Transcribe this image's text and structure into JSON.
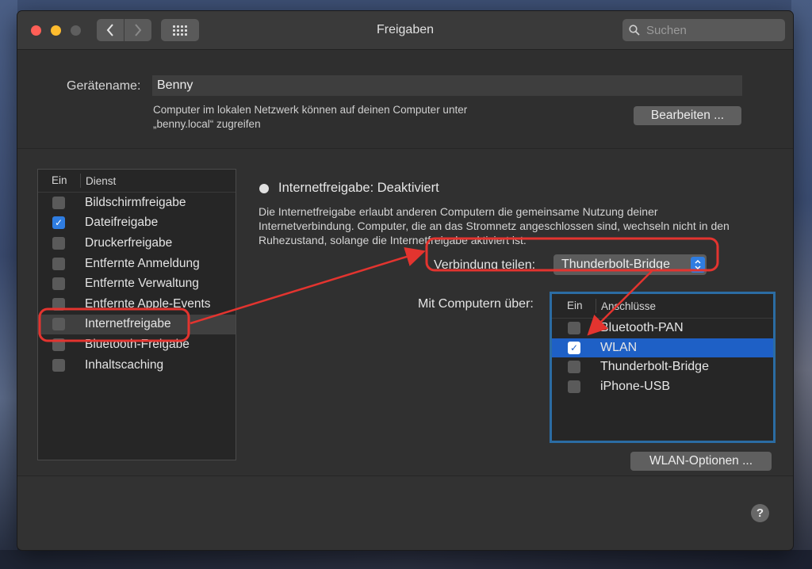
{
  "window": {
    "title": "Freigaben"
  },
  "search": {
    "placeholder": "Suchen"
  },
  "device": {
    "label": "Gerätename:",
    "value": "Benny",
    "hint_line1": "Computer im lokalen Netzwerk können auf deinen Computer unter",
    "hint_line2": "„benny.local“ zugreifen",
    "edit_button": "Bearbeiten ..."
  },
  "services": {
    "header_on": "Ein",
    "header_service": "Dienst",
    "items": [
      {
        "label": "Bildschirmfreigabe",
        "checked": false,
        "selected": false
      },
      {
        "label": "Dateifreigabe",
        "checked": true,
        "selected": false
      },
      {
        "label": "Druckerfreigabe",
        "checked": false,
        "selected": false
      },
      {
        "label": "Entfernte Anmeldung",
        "checked": false,
        "selected": false
      },
      {
        "label": "Entfernte Verwaltung",
        "checked": false,
        "selected": false
      },
      {
        "label": "Entfernte Apple-Events",
        "checked": false,
        "selected": false
      },
      {
        "label": "Internetfreigabe",
        "checked": false,
        "selected": true
      },
      {
        "label": "Bluetooth-Freigabe",
        "checked": false,
        "selected": false
      },
      {
        "label": "Inhaltscaching",
        "checked": false,
        "selected": false
      }
    ]
  },
  "detail": {
    "status": "Internetfreigabe: Deaktiviert",
    "desc_line1": "Die Internetfreigabe erlaubt anderen Computern die gemeinsame Nutzung deiner",
    "desc_line2": "Internetverbindung. Computer, die an das Stromnetz angeschlossen sind, wechseln nicht in den",
    "desc_line3": "Ruhezustand, solange die Internetfreigabe aktiviert ist.",
    "share_label": "Verbindung teilen:",
    "share_value": "Thunderbolt-Bridge",
    "via_label": "Mit Computern über:",
    "ports_header_on": "Ein",
    "ports_header_name": "Anschlüsse",
    "ports": [
      {
        "label": "Bluetooth-PAN",
        "checked": false,
        "selected": false
      },
      {
        "label": "WLAN",
        "checked": true,
        "selected": true
      },
      {
        "label": "Thunderbolt-Bridge",
        "checked": false,
        "selected": false
      },
      {
        "label": "iPhone-USB",
        "checked": false,
        "selected": false
      }
    ],
    "wlan_button": "WLAN-Optionen ..."
  },
  "help": {
    "label": "?"
  },
  "colors": {
    "accent": "#2f7de1",
    "selection": "#1e60c6",
    "annotation": "#e3342f"
  },
  "icons": [
    "close-icon",
    "minimize-icon",
    "zoom-icon",
    "chevron-left-icon",
    "chevron-right-icon",
    "grid-icon",
    "search-icon",
    "checkmark-icon",
    "updown-arrows-icon",
    "help-icon"
  ]
}
